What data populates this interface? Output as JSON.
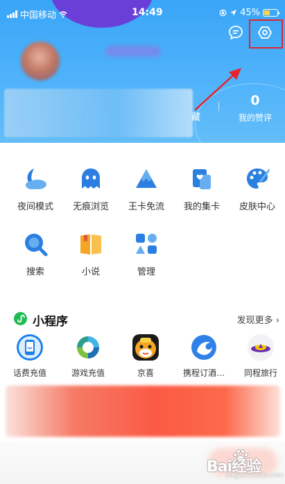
{
  "status_bar": {
    "carrier": "中国移动",
    "time": "14:49",
    "battery": "45%",
    "battery_level": 0.45
  },
  "profile": {
    "stat_partial": "藏",
    "likes_value": "0",
    "likes_label": "我的赞评"
  },
  "tools": [
    {
      "label": "夜间模式",
      "icon": "night-mode-icon"
    },
    {
      "label": "无痕浏览",
      "icon": "ghost-icon"
    },
    {
      "label": "王卡免流",
      "icon": "mountain-icon"
    },
    {
      "label": "我的集卡",
      "icon": "card-collection-icon"
    },
    {
      "label": "皮肤中心",
      "icon": "palette-icon"
    },
    {
      "label": "搜索",
      "icon": "search-icon"
    },
    {
      "label": "小说",
      "icon": "book-icon"
    },
    {
      "label": "管理",
      "icon": "manage-icon"
    }
  ],
  "mini_programs": {
    "title": "小程序",
    "more": "发现更多 ›",
    "items": [
      {
        "label": "话费充值",
        "icon": "phone-recharge-icon"
      },
      {
        "label": "游戏充值",
        "icon": "game-recharge-icon"
      },
      {
        "label": "京喜",
        "icon": "jingxi-icon"
      },
      {
        "label": "携程订酒…",
        "icon": "ctrip-icon"
      },
      {
        "label": "同程旅行",
        "icon": "tongcheng-icon"
      }
    ]
  },
  "watermark": {
    "text": "Bai经验",
    "sub": "jingyan.baidu.com"
  },
  "colors": {
    "header_blue": "#39a5f7",
    "icon_blue": "#2b7fe0",
    "annotation_red": "#e4242c",
    "mini_green": "#1fbb51"
  }
}
